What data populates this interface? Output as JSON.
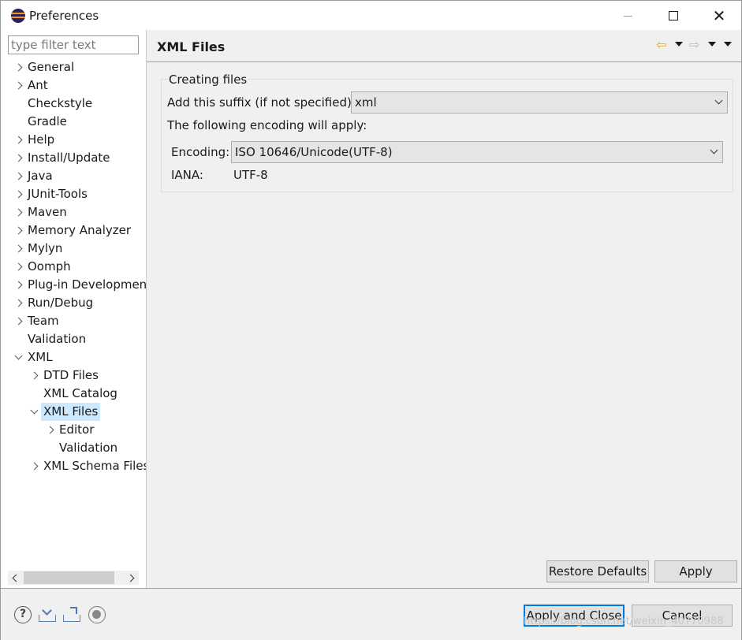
{
  "window": {
    "title": "Preferences",
    "close_glyph": "✕"
  },
  "filter": {
    "placeholder": "type filter text",
    "value": ""
  },
  "tree": {
    "items": [
      {
        "label": "General",
        "twisty": "closed",
        "level": 0
      },
      {
        "label": "Ant",
        "twisty": "closed",
        "level": 0
      },
      {
        "label": "Checkstyle",
        "twisty": "none",
        "level": 0
      },
      {
        "label": "Gradle",
        "twisty": "none",
        "level": 0
      },
      {
        "label": "Help",
        "twisty": "closed",
        "level": 0
      },
      {
        "label": "Install/Update",
        "twisty": "closed",
        "level": 0
      },
      {
        "label": "Java",
        "twisty": "closed",
        "level": 0
      },
      {
        "label": "JUnit-Tools",
        "twisty": "closed",
        "level": 0
      },
      {
        "label": "Maven",
        "twisty": "closed",
        "level": 0
      },
      {
        "label": "Memory Analyzer",
        "twisty": "closed",
        "level": 0
      },
      {
        "label": "Mylyn",
        "twisty": "closed",
        "level": 0
      },
      {
        "label": "Oomph",
        "twisty": "closed",
        "level": 0
      },
      {
        "label": "Plug-in Developmen",
        "twisty": "closed",
        "level": 0
      },
      {
        "label": "Run/Debug",
        "twisty": "closed",
        "level": 0
      },
      {
        "label": "Team",
        "twisty": "closed",
        "level": 0
      },
      {
        "label": "Validation",
        "twisty": "none",
        "level": 0
      },
      {
        "label": "XML",
        "twisty": "open",
        "level": 0
      },
      {
        "label": "DTD Files",
        "twisty": "closed",
        "level": 1
      },
      {
        "label": "XML Catalog",
        "twisty": "none",
        "level": 1
      },
      {
        "label": "XML Files",
        "twisty": "open",
        "level": 1,
        "selected": true
      },
      {
        "label": "Editor",
        "twisty": "closed",
        "level": 2
      },
      {
        "label": "Validation",
        "twisty": "none",
        "level": 2
      },
      {
        "label": "XML Schema Files",
        "twisty": "closed",
        "level": 1
      }
    ]
  },
  "page": {
    "title": "XML Files",
    "nav": {
      "back_icon": "⇦",
      "forward_icon": "⇨"
    },
    "creating_files": {
      "legend": "Creating files",
      "suffix_label": "Add this suffix (if not specified):",
      "suffix_value": "xml",
      "encoding_note": "The following encoding will apply:",
      "encoding_label": "Encoding:",
      "encoding_value": "ISO 10646/Unicode(UTF-8)",
      "iana_label": "IANA:",
      "iana_value": "UTF-8"
    },
    "restore_defaults_label": "Restore Defaults",
    "apply_label": "Apply"
  },
  "bottom": {
    "help_glyph": "?",
    "apply_and_close_label": "Apply and Close",
    "cancel_label": "Cancel",
    "watermark": "https://blog.csdn.net/weixin_40770988"
  },
  "colors": {
    "selection": "#cce8ff",
    "default_button_border": "#0078d7",
    "back_arrow": "#e6a316",
    "panel_bg": "#f0f0f0"
  }
}
